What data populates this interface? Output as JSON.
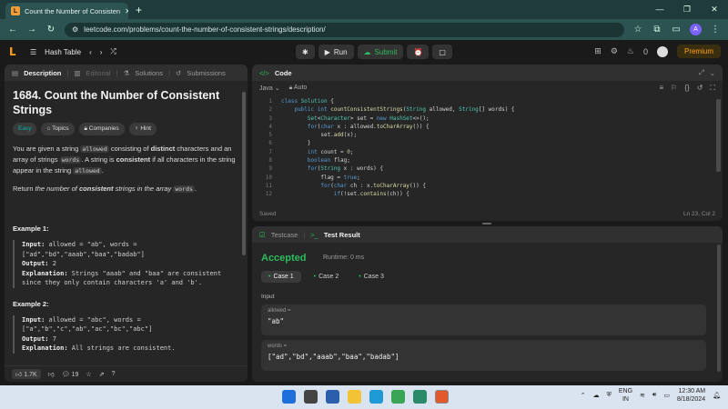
{
  "browser": {
    "tab_title": "Count the Number of Consisten",
    "url": "leetcode.com/problems/count-the-number-of-consistent-strings/description/",
    "profile_initial": "A"
  },
  "toolbar": {
    "problem_list": "Hash Table",
    "run_label": "Run",
    "submit_label": "Submit",
    "streak_count": "0",
    "premium_label": "Premium"
  },
  "left_tabs": [
    "Description",
    "Editorial",
    "Solutions",
    "Submissions"
  ],
  "problem": {
    "title": "1684. Count the Number of Consistent Strings",
    "difficulty": "Easy",
    "chip_topics": "Topics",
    "chip_companies": "Companies",
    "chip_hint": "Hint",
    "p1_a": "You are given a string ",
    "p1_code1": "allowed",
    "p1_b": " consisting of ",
    "p1_bold": "distinct",
    "p1_c": " characters and an array of strings ",
    "p1_code2": "words",
    "p1_d": ". A string is ",
    "p1_bold2": "consistent",
    "p1_e": " if all characters in the string appear in the string ",
    "p1_code3": "allowed",
    "p1_f": ".",
    "p2_a": "Return ",
    "p2_i1": "the number of ",
    "p2_bi": "consistent",
    "p2_i2": " strings in the array ",
    "p2_code": "words",
    "p2_b": "."
  },
  "examples": [
    {
      "title": "Example 1:",
      "input_label": "Input:",
      "input": " allowed = \"ab\", words = [\"ad\",\"bd\",\"aaab\",\"baa\",\"badab\"]",
      "output_label": "Output:",
      "output": " 2",
      "expl_label": "Explanation:",
      "expl": " Strings \"aaab\" and \"baa\" are consistent since they only contain characters 'a' and 'b'."
    },
    {
      "title": "Example 2:",
      "input_label": "Input:",
      "input": " allowed = \"abc\", words = [\"a\",\"b\",\"c\",\"ab\",\"ac\",\"bc\",\"abc\"]",
      "output_label": "Output:",
      "output": " 7",
      "expl_label": "Explanation:",
      "expl": " All strings are consistent."
    }
  ],
  "left_footer": {
    "likes": "1.7K",
    "comments": "19"
  },
  "code_panel": {
    "title": "Code",
    "language": "Java",
    "mode": "Auto",
    "status": "Saved",
    "cursor": "Ln 23, Col 2",
    "line_numbers": [
      "1",
      "2",
      "3",
      "4",
      "5",
      "6",
      "7",
      "8",
      "9",
      "10",
      "11",
      "12"
    ]
  },
  "result_panel": {
    "tab_testcase": "Testcase",
    "tab_result": "Test Result",
    "verdict": "Accepted",
    "runtime": "Runtime: 0 ms",
    "cases": [
      "Case 1",
      "Case 2",
      "Case 3"
    ],
    "input_label": "Input",
    "var1_name": "allowed =",
    "var1_value": "\"ab\"",
    "var2_name": "words =",
    "var2_value": "[\"ad\",\"bd\",\"aaab\",\"baa\",\"badab\"]"
  },
  "taskbar": {
    "lang1": "ENG",
    "lang2": "IN",
    "time": "12:30 AM",
    "date": "8/18/2024"
  }
}
